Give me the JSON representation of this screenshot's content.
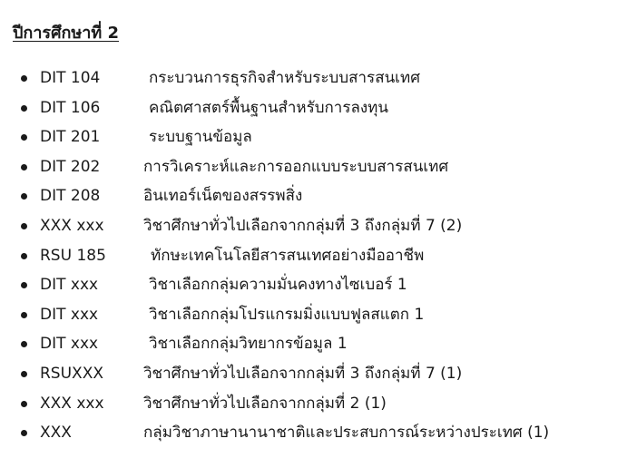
{
  "heading": "ปีการศึกษาที่ 2",
  "courses": [
    {
      "code": "DIT 104",
      "title": "กระบวนการธุรกิจสำหรับระบบสารสนเทศ"
    },
    {
      "code": "DIT 106",
      "title": "คณิตศาสตร์พื้นฐานสำหรับการลงทุน"
    },
    {
      "code": "DIT 201",
      "title": "ระบบฐานข้อมูล"
    },
    {
      "code": "DIT 202",
      "title": "การวิเคราะห์และการออกแบบระบบสารสนเทศ"
    },
    {
      "code": "DIT 208",
      "title": "อินเทอร์เน็ตของสรรพสิ่ง"
    },
    {
      "code": "XXX xxx",
      "title": "วิชาศึกษาทั่วไปเลือกจากกลุ่มที่ 3 ถึงกลุ่มที่ 7 (2)"
    },
    {
      "code": "RSU 185",
      "title": "ทักษะเทคโนโลยีสารสนเทศอย่างมืออาชีพ"
    },
    {
      "code": "DIT xxx",
      "title": "วิชาเลือกกลุ่มความมั่นคงทางไซเบอร์ 1"
    },
    {
      "code": "DIT xxx",
      "title": "วิชาเลือกกลุ่มโปรแกรมมิ่งแบบฟูลสแตก 1"
    },
    {
      "code": "DIT xxx",
      "title": "วิชาเลือกกลุ่มวิทยากรข้อมูล 1"
    },
    {
      "code": "RSUXXX",
      "title": "วิชาศึกษาทั่วไปเลือกจากกลุ่มที่ 3 ถึงกลุ่มที่ 7 (1)"
    },
    {
      "code": "XXX xxx",
      "title": "วิชาศึกษาทั่วไปเลือกจากกลุ่มที่ 2 (1)"
    },
    {
      "code": "XXX",
      "title": "กลุ่มวิชาภาษานานาชาติและประสบการณ์ระหว่างประเทศ (1)"
    }
  ]
}
